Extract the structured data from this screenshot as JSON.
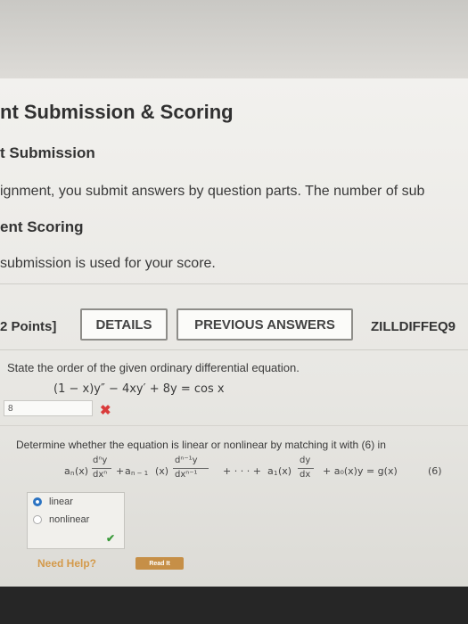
{
  "header": {
    "title": "nt Submission & Scoring",
    "sub1": "t Submission",
    "para1": "ignment, you submit answers by question parts. The number of sub",
    "sub2": "ent Scoring",
    "para2": "submission is used for your score."
  },
  "question": {
    "points": "2 Points]",
    "details_label": "DETAILS",
    "prev_label": "PREVIOUS ANSWERS",
    "code": "ZILLDIFFEQ9",
    "part1_prompt": "State the order of the given ordinary differential equation.",
    "part1_equation": "(1 − x)y″ − 4xy′ + 8y = cos x",
    "part1_answer": "8",
    "part2_prompt": "Determine whether the equation is linear or nonlinear by matching it with (6) in",
    "eq_label": "(6)",
    "options": [
      "linear",
      "nonlinear"
    ],
    "selected": "linear",
    "need_help": "Need Help?",
    "read_it": "Read It"
  },
  "equation6": {
    "t1_coef": "a",
    "t1_sub": "n",
    "t1_x": "(x)",
    "t1_num": "dⁿy",
    "t1_den": "dxⁿ",
    "plus1": "+",
    "t2_coef": "a",
    "t2_sub": "n − 1",
    "t2_x": "(x)",
    "t2_num": "dⁿ⁻¹y",
    "t2_den": "dxⁿ⁻¹",
    "dots": "+ · · · +",
    "t3_coef": "a",
    "t3_sub": "1",
    "t3_x": "(x)",
    "t3_num": "dy",
    "t3_den": "dx",
    "t4": "+ a₀(x)y = g(x)"
  },
  "colors": {
    "accent": "#2b73c2",
    "error": "#d93b3b",
    "success": "#3a9a3a",
    "help": "#d49a4b"
  }
}
